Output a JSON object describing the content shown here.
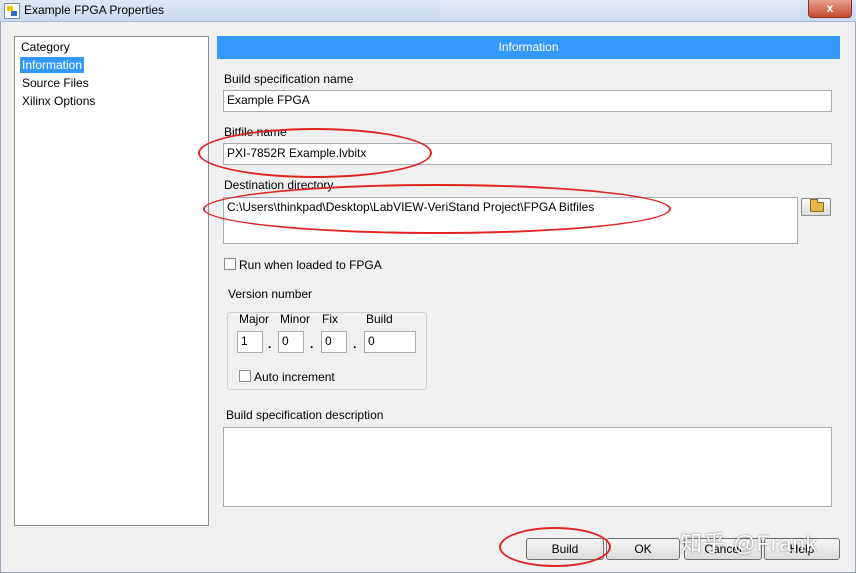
{
  "window": {
    "title": "Example FPGA Properties",
    "close_label": "x"
  },
  "category": {
    "header": "Category",
    "items": [
      {
        "label": "Information",
        "selected": true
      },
      {
        "label": "Source Files",
        "selected": false
      },
      {
        "label": "Xilinx Options",
        "selected": false
      }
    ]
  },
  "info": {
    "section_title": "Information",
    "build_spec_name_label": "Build specification name",
    "build_spec_name_value": "Example FPGA",
    "bitfile_name_label": "Bitfile name",
    "bitfile_name_value": "PXI-7852R Example.lvbitx",
    "destination_label": "Destination directory",
    "destination_value": "C:\\Users\\thinkpad\\Desktop\\LabVIEW-VeriStand Project\\FPGA Bitfiles",
    "run_when_loaded_label": "Run when loaded to FPGA",
    "run_when_loaded_checked": false,
    "version_label": "Version number",
    "version": {
      "major_label": "Major",
      "minor_label": "Minor",
      "fix_label": "Fix",
      "build_label": "Build",
      "major": "1",
      "minor": "0",
      "fix": "0",
      "build": "0"
    },
    "auto_increment_label": "Auto increment",
    "auto_increment_checked": false,
    "description_label": "Build specification description",
    "description_value": ""
  },
  "buttons": {
    "build": "Build",
    "ok": "OK",
    "cancel": "Cancel",
    "help": "Help"
  },
  "watermark": "知乎 @Frank",
  "colors": {
    "accent": "#3399ff",
    "annotation": "#e02424"
  },
  "icons": {
    "browse": "folder-open-icon"
  }
}
